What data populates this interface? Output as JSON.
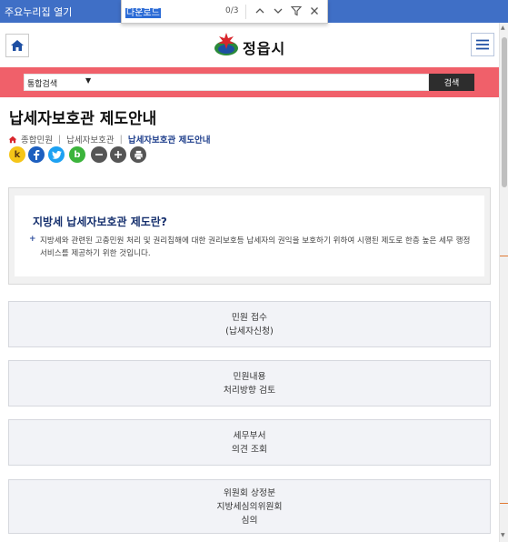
{
  "topbar": {
    "skip_link": "주요누리집 열기"
  },
  "find": {
    "query": "다운로드",
    "count": "0/3"
  },
  "header": {
    "logo_text": "정읍시"
  },
  "search": {
    "scope": "통합검색",
    "button": "검색"
  },
  "page": {
    "title": "납세자보호관 제도안내"
  },
  "breadcrumb": [
    "종합민원",
    "납세자보호관",
    "납세자보호관 제도안내"
  ],
  "share": {
    "kakaostory": "k",
    "band": "b"
  },
  "info": {
    "heading": "지방세 납세자보호관 제도란?",
    "body": "지방세와 관련된 고충민원 처리 및 권리침해에 대한 권리보호등 납세자의 권익을 보호하기 위하여 시행된 제도로 한층 높은 세무 행정 서비스를 제공하기 위한 것입니다."
  },
  "steps": [
    {
      "line1": "민원 접수",
      "line2": "(납세자신청)"
    },
    {
      "line1": "민원내용",
      "line2": "처리방향 검토"
    },
    {
      "line1": "세무부서",
      "line2": "의견 조회"
    },
    {
      "line1": "위원회 상정분",
      "line2": "지방세심의위원회",
      "line3": "심의"
    }
  ],
  "colors": {
    "topbar": "#3f6fc6",
    "search_band": "#f0606a",
    "title_blue": "#16306e"
  }
}
